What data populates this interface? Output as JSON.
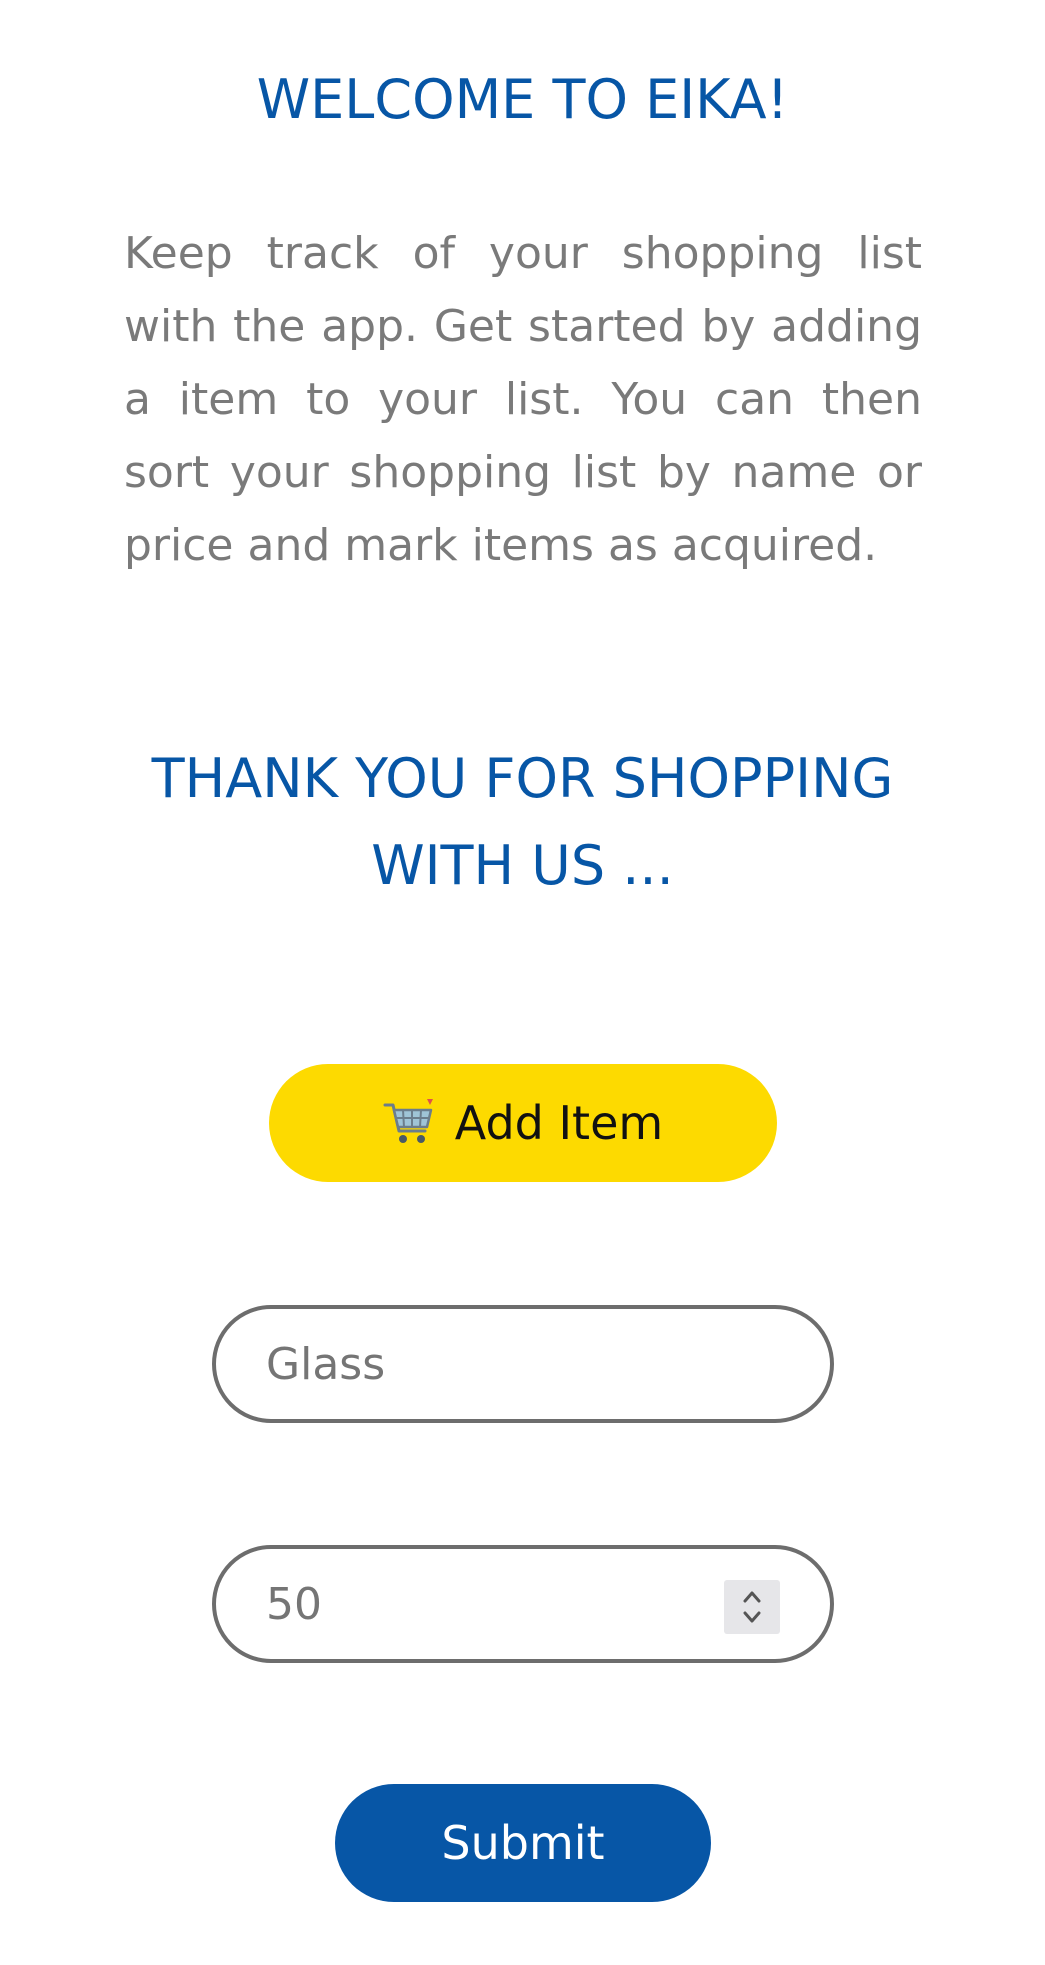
{
  "header": {
    "title": "WELCOME TO EIKA!"
  },
  "intro": {
    "text": "Keep track of your shopping list with the app. Get started by adding a item to your list. You can then sort your shopping list by name or price and mark items as acquired."
  },
  "thanks": {
    "line1": "THANK YOU FOR SHOPPING",
    "line2": "WITH US ..."
  },
  "add_item_button": {
    "icon": "shopping-cart-icon",
    "label": "Add Item"
  },
  "form": {
    "name_field": {
      "placeholder": "Glass"
    },
    "price_field": {
      "placeholder": "50"
    },
    "submit_label": "Submit"
  },
  "colors": {
    "brand_blue": "#0756a6",
    "brand_yellow": "#fdda00",
    "text_gray": "#7a7a7a",
    "border_gray": "#6d6d6d"
  }
}
